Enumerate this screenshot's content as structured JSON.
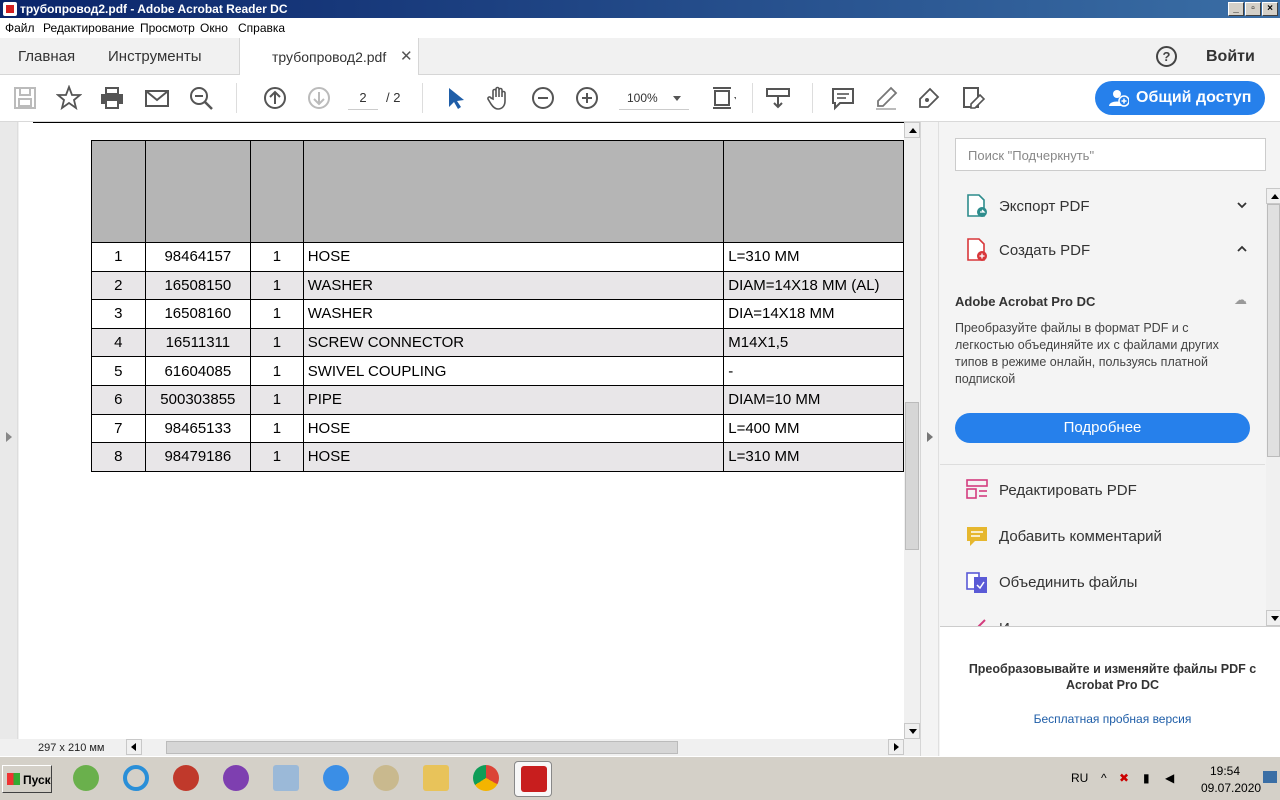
{
  "window": {
    "title": "трубопровод2.pdf - Adobe Acrobat Reader DC"
  },
  "menu": [
    "Файл",
    "Редактирование",
    "Просмотр",
    "Окно",
    "Справка"
  ],
  "tabs": {
    "home": "Главная",
    "tools": "Инструменты",
    "document": "трубопровод2.pdf",
    "signin": "Войти"
  },
  "toolbar": {
    "page_current": "2",
    "page_total": "/ 2",
    "zoom": "100%",
    "share": "Общий доступ"
  },
  "table": {
    "rows": [
      [
        "1",
        "98464157",
        "1",
        "HOSE",
        "L=310 MM"
      ],
      [
        "2",
        "16508150",
        "1",
        "WASHER",
        "DIAM=14X18 MM (AL)"
      ],
      [
        "3",
        "16508160",
        "1",
        "WASHER",
        "DIA=14X18 MM"
      ],
      [
        "4",
        "16511311",
        "1",
        "SCREW CONNECTOR",
        "M14X1,5"
      ],
      [
        "5",
        "61604085",
        "1",
        "SWIVEL COUPLING",
        "-"
      ],
      [
        "6",
        "500303855",
        "1",
        "PIPE",
        "DIAM=10 MM"
      ],
      [
        "7",
        "98465133",
        "1",
        "HOSE",
        "L=400 MM"
      ],
      [
        "8",
        "98479186",
        "1",
        "HOSE",
        "L=310 MM"
      ]
    ]
  },
  "statusbar": {
    "page_size": "297 x 210 мм"
  },
  "rightpane": {
    "search_placeholder": "Поиск \"Подчеркнуть\"",
    "export_pdf": "Экспорт PDF",
    "create_pdf": "Создать PDF",
    "promo_title": "Adobe Acrobat Pro DC",
    "promo_desc": "Преобразуйте файлы в формат PDF и с легкостью объединяйте их с файлами других типов в режиме онлайн, пользуясь платной подпиской",
    "more_button": "Подробнее",
    "edit_pdf": "Редактировать PDF",
    "add_comment": "Добавить комментарий",
    "combine_files": "Объединить файлы",
    "partial_item": "И",
    "footer_text": "Преобразовывайте и изменяйте файлы PDF с Acrobat Pro DC",
    "footer_link": "Бесплатная пробная версия"
  },
  "taskbar": {
    "start": "Пуск",
    "lang": "RU",
    "time": "19:54",
    "date": "09.07.2020"
  },
  "colors": {
    "accent": "#2680eb",
    "title_bar": "#0a246a",
    "table_header": "#b5b5b5",
    "row_alt": "#e8e6e8"
  }
}
